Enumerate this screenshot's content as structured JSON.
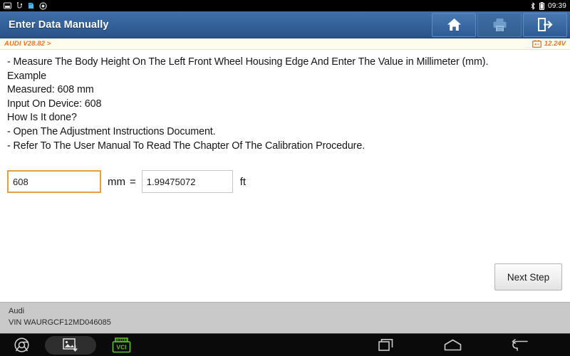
{
  "statusbar": {
    "icons": [
      "screenshot-icon",
      "usb-icon",
      "sdcard-icon",
      "sync-icon"
    ],
    "bluetooth_icon": "bluetooth-icon",
    "battery_icon": "battery-icon",
    "time": "09:39"
  },
  "header": {
    "title": "Enter Data Manually",
    "buttons": [
      {
        "name": "home-button",
        "icon": "home-icon",
        "enabled": true
      },
      {
        "name": "print-button",
        "icon": "printer-icon",
        "enabled": false
      },
      {
        "name": "exit-button",
        "icon": "exit-icon",
        "enabled": true
      }
    ]
  },
  "substrip": {
    "version": "AUDI V28.82 >",
    "battery_icon": "car-battery-icon",
    "voltage": "12.24V",
    "accent_color": "#e8741d"
  },
  "content": {
    "instructions": [
      "- Measure The Body Height On The Left Front Wheel Housing Edge And Enter The Value in Millimeter (mm).",
      "Example",
      "Measured: 608 mm",
      "Input On Device: 608",
      "How Is It done?",
      "- Open The Adjustment Instructions Document.",
      "- Refer To The User Manual To Read The Chapter Of The Calibration Procedure."
    ],
    "entry": {
      "input_value": "608",
      "input_placeholder": "",
      "input_unit": "mm",
      "equals": "=",
      "converted_value": "1.99475072",
      "converted_placeholder": "",
      "converted_unit": "ft",
      "focus_color": "#e0a33c"
    },
    "next_step_label": "Next Step"
  },
  "footer": {
    "make": "Audi",
    "vin": "VIN WAURGCF12MD046085"
  },
  "navbar": {
    "left": [
      {
        "name": "browser-icon"
      },
      {
        "name": "screenshot-save-icon"
      },
      {
        "name": "vci-icon",
        "label": "VCI",
        "color": "#5cc22a"
      }
    ],
    "right": [
      {
        "name": "recent-apps-icon"
      },
      {
        "name": "home-icon"
      },
      {
        "name": "back-icon"
      }
    ]
  }
}
